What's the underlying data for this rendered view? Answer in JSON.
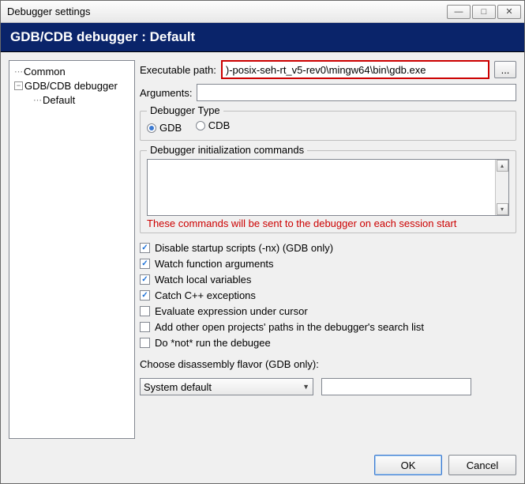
{
  "window": {
    "title": "Debugger settings"
  },
  "header": {
    "title": "GDB/CDB debugger : Default"
  },
  "tree": {
    "common": "Common",
    "gdbcdb": "GDB/CDB debugger",
    "default": "Default"
  },
  "form": {
    "exe_label": "Executable path:",
    "exe_value": ")-posix-seh-rt_v5-rev0\\mingw64\\bin\\gdb.exe",
    "browse": "...",
    "args_label": "Arguments:",
    "args_value": "",
    "type_group": "Debugger Type",
    "radio_gdb": "GDB",
    "radio_cdb": "CDB",
    "init_group": "Debugger initialization commands",
    "init_hint": "These commands will be sent to the debugger on each session start",
    "checks": [
      {
        "label": "Disable startup scripts (-nx) (GDB only)",
        "checked": true
      },
      {
        "label": "Watch function arguments",
        "checked": true
      },
      {
        "label": "Watch local variables",
        "checked": true
      },
      {
        "label": "Catch C++ exceptions",
        "checked": true
      },
      {
        "label": "Evaluate expression under cursor",
        "checked": false
      },
      {
        "label": "Add other open projects' paths in the debugger's search list",
        "checked": false
      },
      {
        "label": "Do *not* run the debugee",
        "checked": false
      }
    ],
    "disasm_label": "Choose disassembly flavor (GDB only):",
    "disasm_value": "System default"
  },
  "buttons": {
    "ok": "OK",
    "cancel": "Cancel"
  }
}
